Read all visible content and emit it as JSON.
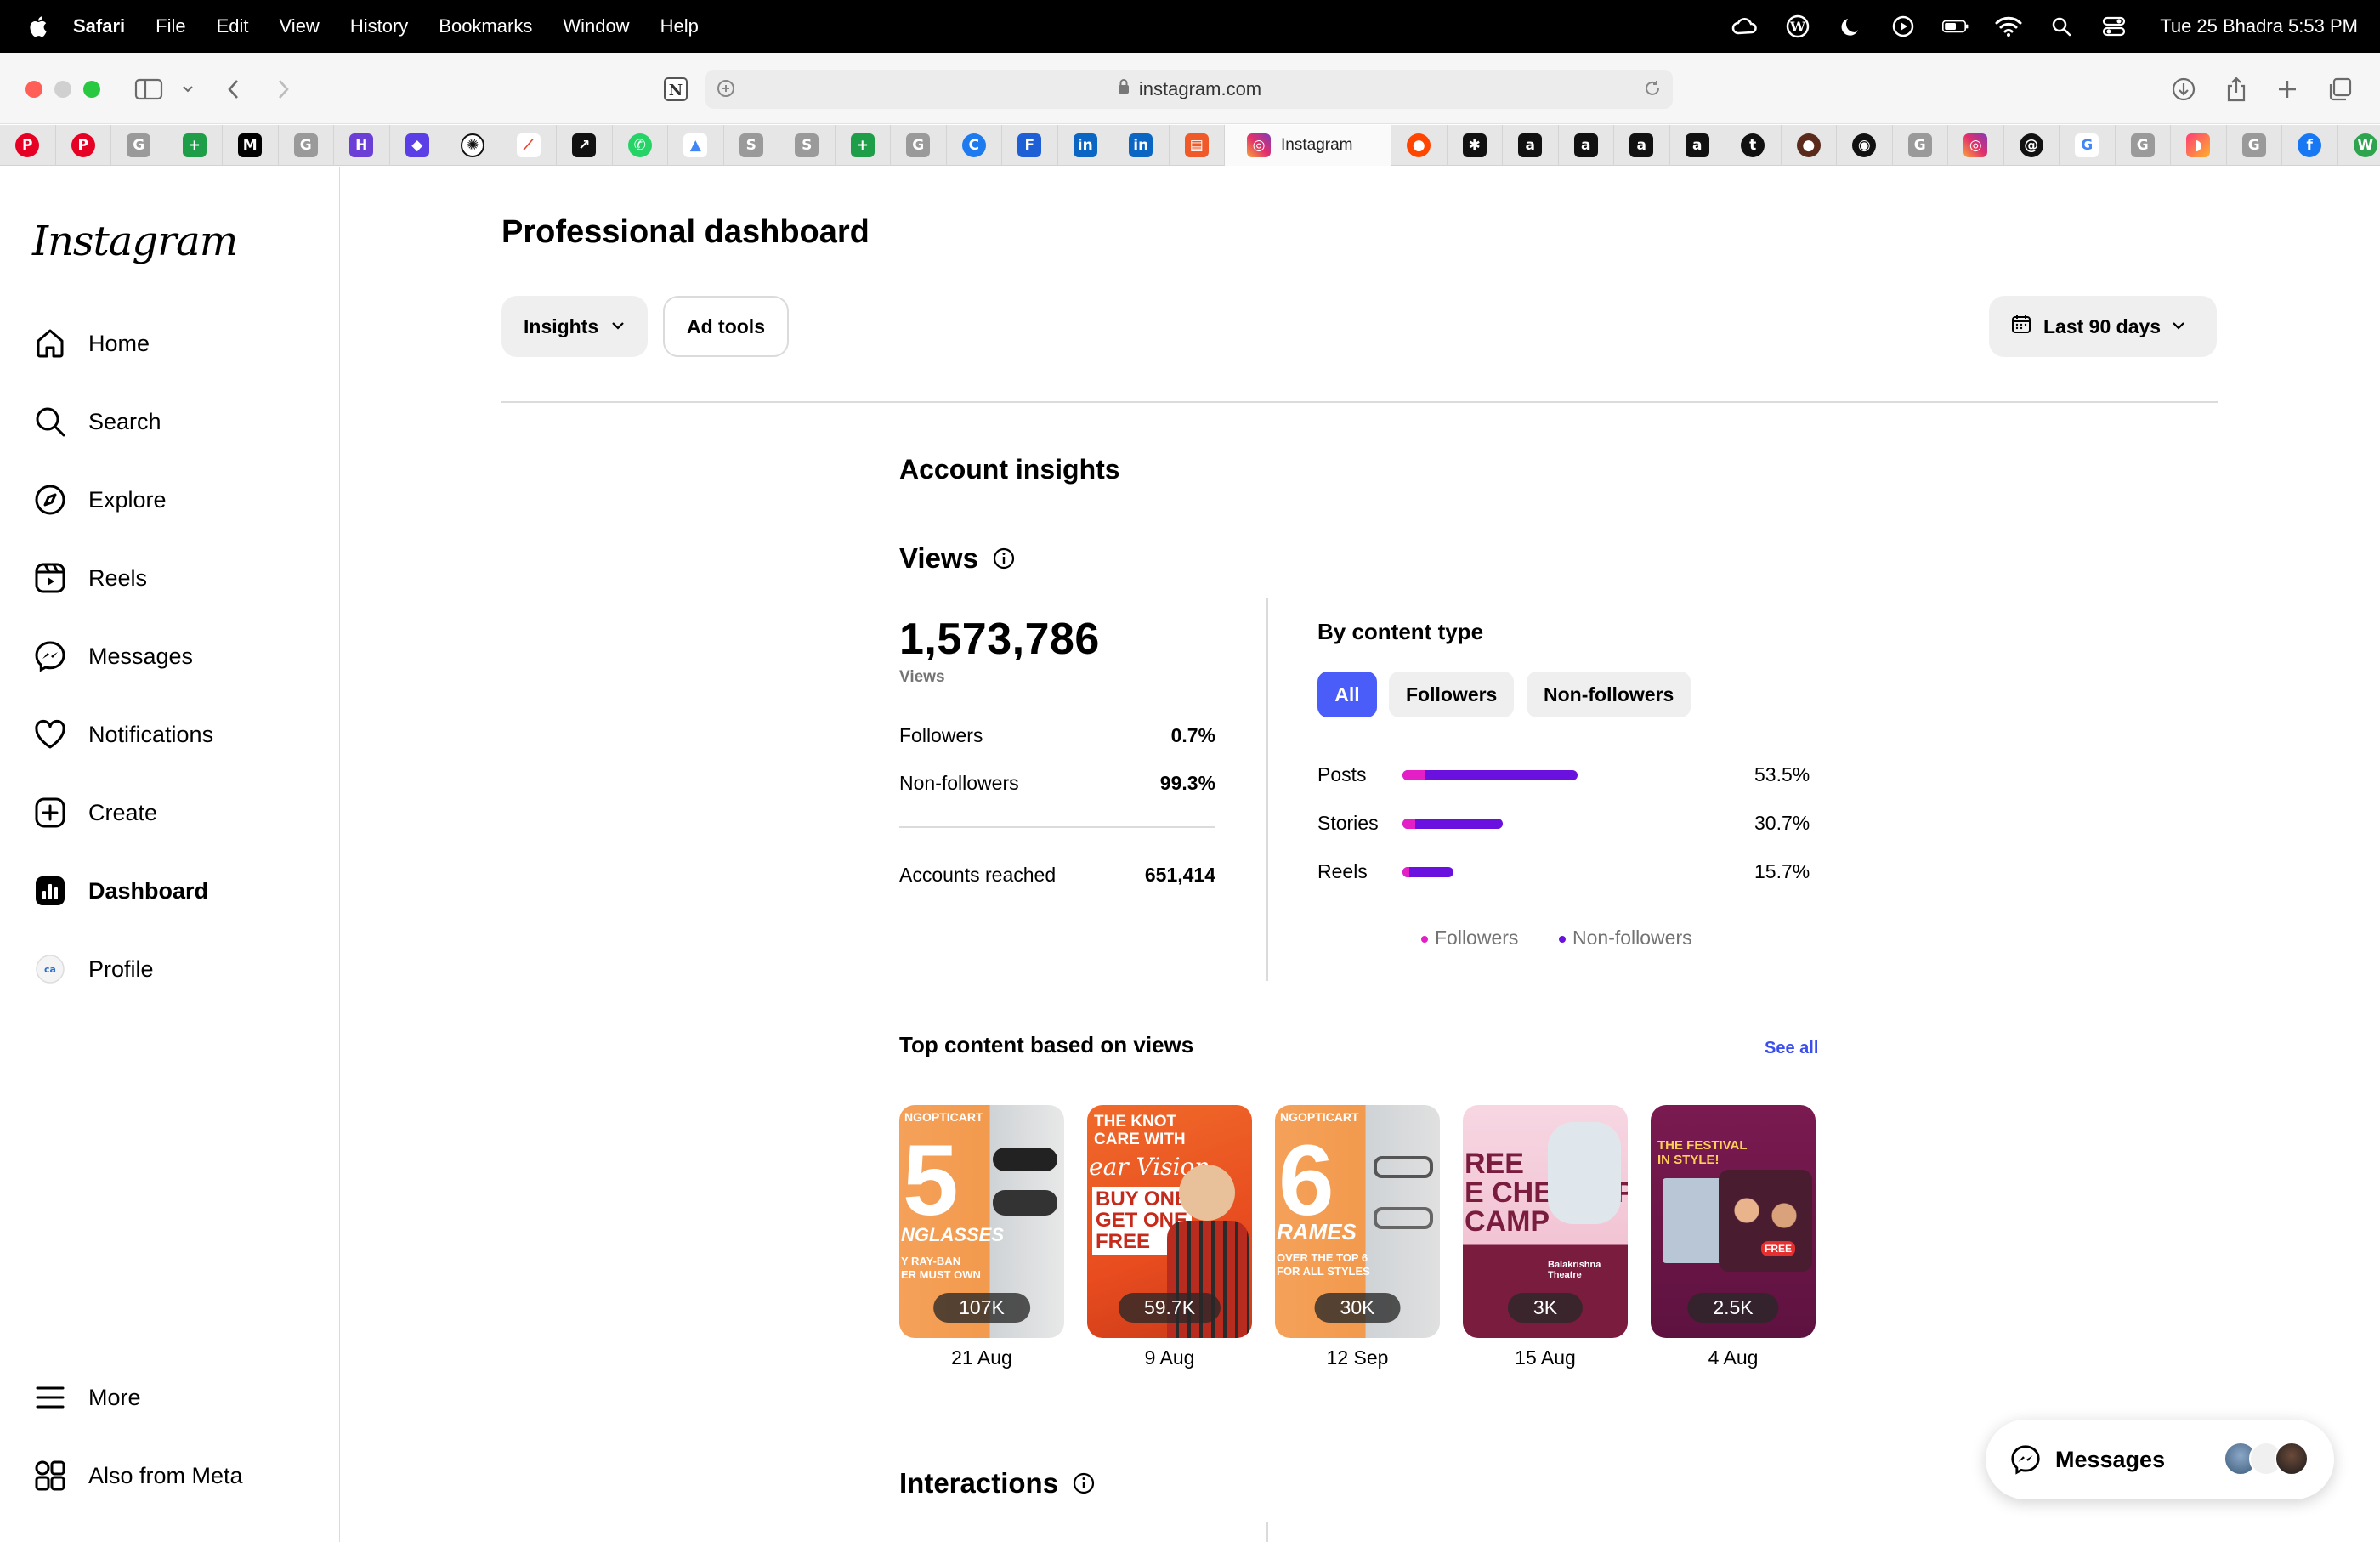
{
  "menubar": {
    "app": "Safari",
    "items": [
      "File",
      "Edit",
      "View",
      "History",
      "Bookmarks",
      "Window",
      "Help"
    ],
    "clock": "Tue 25 Bhadra  5:53 PM"
  },
  "browser": {
    "url": "instagram.com",
    "active_tab": "Instagram"
  },
  "sidebar": {
    "logo": "Instagram",
    "items": [
      {
        "label": "Home",
        "icon": "home-icon"
      },
      {
        "label": "Search",
        "icon": "search-icon"
      },
      {
        "label": "Explore",
        "icon": "compass-icon"
      },
      {
        "label": "Reels",
        "icon": "reels-icon"
      },
      {
        "label": "Messages",
        "icon": "messenger-icon"
      },
      {
        "label": "Notifications",
        "icon": "heart-icon"
      },
      {
        "label": "Create",
        "icon": "plus-square-icon"
      },
      {
        "label": "Dashboard",
        "icon": "dashboard-icon"
      },
      {
        "label": "Profile",
        "icon": "avatar"
      }
    ],
    "bottom": [
      {
        "label": "More",
        "icon": "menu-icon"
      },
      {
        "label": "Also from Meta",
        "icon": "meta-apps-icon"
      }
    ]
  },
  "page": {
    "title": "Professional dashboard",
    "insights_button": "Insights",
    "ad_tools_button": "Ad tools",
    "date_range": "Last 90 days",
    "account_insights": "Account insights",
    "views_title": "Views",
    "views_total": "1,573,786",
    "views_caption": "Views",
    "followers_label": "Followers",
    "followers_value": "0.7%",
    "nonfollowers_label": "Non-followers",
    "nonfollowers_value": "99.3%",
    "reached_label": "Accounts reached",
    "reached_value": "651,414",
    "by_content_type": "By content type",
    "filters": [
      "All",
      "Followers",
      "Non-followers"
    ],
    "content_rows": [
      {
        "label": "Posts",
        "value": "53.5%",
        "fraction": 0.535
      },
      {
        "label": "Stories",
        "value": "30.7%",
        "fraction": 0.307
      },
      {
        "label": "Reels",
        "value": "15.7%",
        "fraction": 0.157
      }
    ],
    "legend": [
      "Followers",
      "Non-followers"
    ],
    "top_content_title": "Top content based on views",
    "see_all": "See all",
    "top_content": [
      {
        "views": "107K",
        "date": "21 Aug",
        "overlay": "5",
        "sub": "NGLASSES",
        "sub2": "Y RAY-BAN\nER MUST OWN",
        "brand": "NGOPTICART"
      },
      {
        "views": "59.7K",
        "date": "9 Aug",
        "overlay": "THE KNOT\nCARE WITH",
        "sub": "BUY ONE\nGET ONE\nFREE",
        "sub2": "ear Vision"
      },
      {
        "views": "30K",
        "date": "12 Sep",
        "overlay": "6",
        "sub": "RAMES",
        "sub2": "OVER THE TOP 6\nFOR ALL STYLES",
        "brand": "NGOPTICART"
      },
      {
        "views": "3K",
        "date": "15 Aug",
        "overlay": "REE\nE CHECKUP\nCAMP",
        "sub": "Balakrishna Theatre"
      },
      {
        "views": "2.5K",
        "date": "4 Aug",
        "overlay": "THE FESTIVAL\nIN STYLE!",
        "sub": "FREE"
      }
    ],
    "interactions_title": "Interactions",
    "messages_fab": "Messages"
  },
  "colors": {
    "accent": "#4a5df9",
    "followers": "#e41fc5",
    "non_followers": "#6a11e0",
    "link": "#3a4ef0"
  }
}
